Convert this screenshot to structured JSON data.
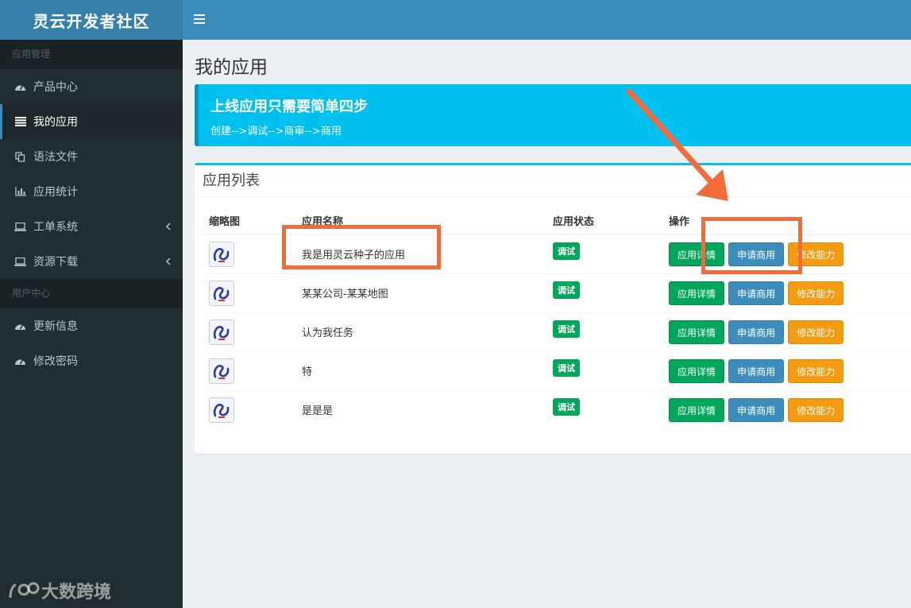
{
  "app": {
    "title": "灵云开发者社区"
  },
  "sidebar": {
    "sections": [
      {
        "header": "应用管理"
      },
      {
        "header": "用户中心"
      }
    ],
    "items": [
      {
        "label": "产品中心",
        "icon": "dashboard-icon"
      },
      {
        "label": "我的应用",
        "icon": "list-icon",
        "active": true
      },
      {
        "label": "语法文件",
        "icon": "copy-icon"
      },
      {
        "label": "应用统计",
        "icon": "bar-chart-icon"
      },
      {
        "label": "工单系统",
        "icon": "laptop-icon",
        "has_children": true
      },
      {
        "label": "资源下载",
        "icon": "laptop-icon",
        "has_children": true
      },
      {
        "label": "更新信息",
        "icon": "dashboard-icon"
      },
      {
        "label": "修改密码",
        "icon": "dashboard-icon"
      }
    ]
  },
  "header": {
    "menu_icon": "hamburger-icon"
  },
  "page": {
    "title": "我的应用",
    "callout": {
      "title": "上线应用只需要简单四步",
      "text": "创建-->调试-->商审-->商用"
    },
    "box_title": "应用列表",
    "table": {
      "headers": [
        "缩略图",
        "应用名称",
        "应用状态",
        "操作"
      ],
      "rows": [
        {
          "name": "我是用灵云种子的应用",
          "status": "调试"
        },
        {
          "name": "某某公司-某某地图",
          "status": "调试"
        },
        {
          "name": "认为我任务",
          "status": "调试"
        },
        {
          "name": "特",
          "status": "调试"
        },
        {
          "name": "是是是",
          "status": "调试"
        }
      ],
      "actions": {
        "detail": "应用详情",
        "apply": "申请商用",
        "modify": "修改能力"
      }
    }
  },
  "watermark": "大数跨境",
  "colors": {
    "annotation": "#f36b3b",
    "sidebar": "#222d32",
    "header": "#3c8dbc",
    "callout": "#00c0ef"
  }
}
